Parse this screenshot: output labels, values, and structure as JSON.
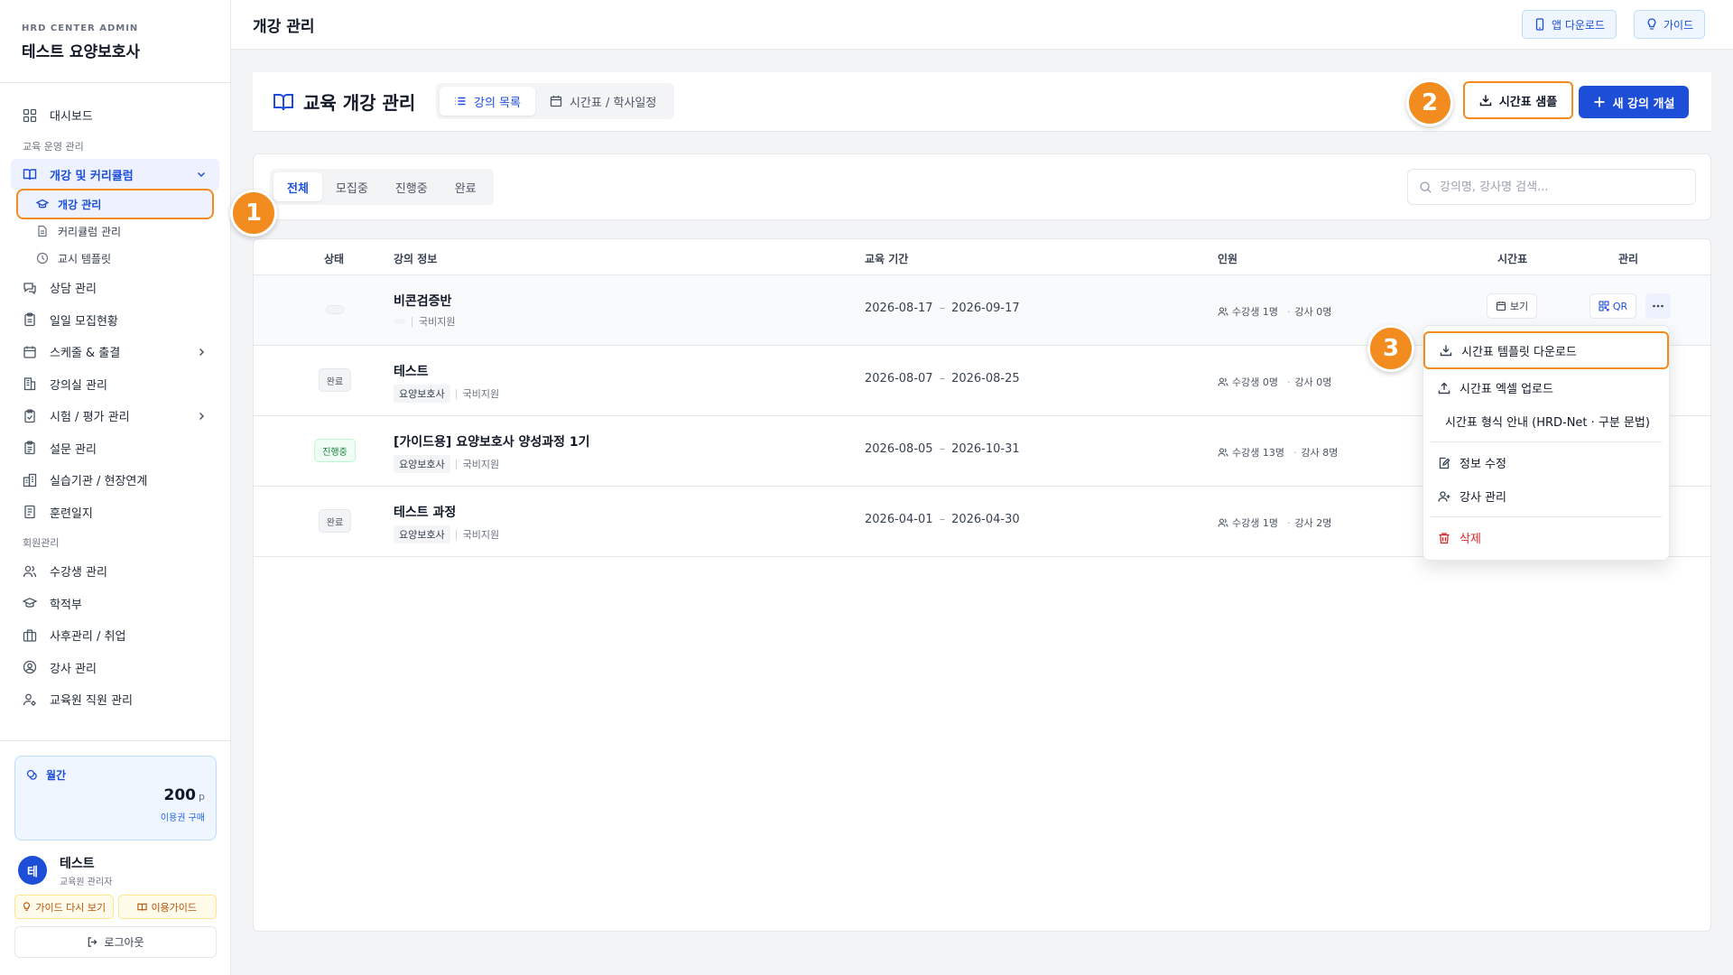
{
  "brand": {
    "eyebrow": "HRD CENTER ADMIN",
    "name": "테스트 요양보호사"
  },
  "header": {
    "title": "개강 관리",
    "app_download": "앱 다운로드",
    "guide": "가이드"
  },
  "sidebar": {
    "dashboard": "대시보드",
    "section_ops": "교육 운영 관리",
    "group_course": "개강 및 커리큘럼",
    "sub_course": "개강 관리",
    "sub_curriculum": "커리큘럼 관리",
    "sub_period": "교시 템플릿",
    "items_ops": [
      "상담 관리",
      "일일 모집현황",
      "스케줄 & 출결",
      "강의실 관리",
      "시험 / 평가 관리",
      "설문 관리",
      "실습기관 / 현장연계",
      "훈련일지"
    ],
    "section_members": "회원관리",
    "items_members": [
      "수강생 관리",
      "학적부",
      "사후관리 / 취업",
      "강사 관리",
      "교육원 직원 관리"
    ],
    "credit_label": "월간",
    "credit_amount": "200",
    "credit_unit": "p",
    "credit_buy": "이용권 구매",
    "user_initial": "테",
    "user_name": "테스트",
    "user_role": "교육원 관리자",
    "guide_again": "가이드 다시 보기",
    "usage_guide": "이용가이드",
    "logout": "로그아웃"
  },
  "page": {
    "title": "교육 개강 관리",
    "view_tabs": [
      "강의 목록",
      "시간표 / 학사일정"
    ],
    "sample_btn": "시간표 샘플",
    "new_btn": "새 강의 개설"
  },
  "filters": {
    "tabs": [
      "전체",
      "모집중",
      "진행중",
      "완료"
    ],
    "search_placeholder": "강의명, 강사명 검색..."
  },
  "table": {
    "headers": [
      "상태",
      "강의 정보",
      "교육 기간",
      "인원",
      "시간표",
      "관리"
    ],
    "rows": [
      {
        "status": "",
        "name": "비콘검증반",
        "tag": "",
        "funding": "국비지원",
        "start": "2026-08-17",
        "end": "2026-09-17",
        "students": "수강생 1명",
        "instructors": "강사 0명"
      },
      {
        "status": "완료",
        "name": "테스트",
        "tag": "요양보호사",
        "funding": "국비지원",
        "start": "2026-08-07",
        "end": "2026-08-25",
        "students": "수강생 0명",
        "instructors": "강사 0명"
      },
      {
        "status": "진행중",
        "name": "[가이드용] 요양보호사 양성과정 1기",
        "tag": "요양보호사",
        "funding": "국비지원",
        "start": "2026-08-05",
        "end": "2026-10-31",
        "students": "수강생 13명",
        "instructors": "강사 8명"
      },
      {
        "status": "완료",
        "name": "테스트 과정",
        "tag": "요양보호사",
        "funding": "국비지원",
        "start": "2026-04-01",
        "end": "2026-04-30",
        "students": "수강생 1명",
        "instructors": "강사 2명"
      }
    ],
    "view_label": "보기",
    "qr_label": "QR",
    "period_dash": "–",
    "dot": "·"
  },
  "menu": {
    "download_template": "시간표 템플릿 다운로드",
    "upload_excel": "시간표 엑셀 업로드",
    "format_guide": "시간표 형식 안내 (HRD-Net · 구분 문법)",
    "edit_info": "정보 수정",
    "manage_instructors": "강사 관리",
    "delete": "삭제"
  },
  "callouts": [
    "1",
    "2",
    "3"
  ],
  "colors": {
    "accent": "#1d4ed8",
    "callout": "#f28c1e",
    "danger": "#dc2626",
    "success": "#15803d"
  }
}
